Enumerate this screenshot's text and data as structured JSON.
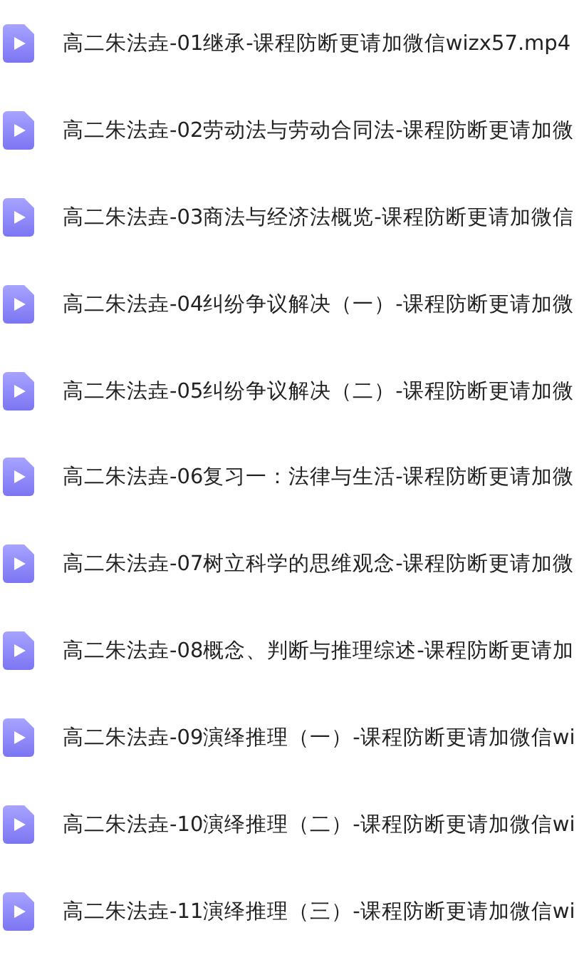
{
  "files": [
    {
      "name": "高二朱法垚-01继承-课程防断更请加微信wizx57.mp4"
    },
    {
      "name": "高二朱法垚-02劳动法与劳动合同法-课程防断更请加微"
    },
    {
      "name": "高二朱法垚-03商法与经济法概览-课程防断更请加微信"
    },
    {
      "name": "高二朱法垚-04纠纷争议解决（一）-课程防断更请加微"
    },
    {
      "name": "高二朱法垚-05纠纷争议解决（二）-课程防断更请加微"
    },
    {
      "name": "高二朱法垚-06复习一：法律与生活-课程防断更请加微"
    },
    {
      "name": "高二朱法垚-07树立科学的思维观念-课程防断更请加微"
    },
    {
      "name": "高二朱法垚-08概念、判断与推理综述-课程防断更请加"
    },
    {
      "name": "高二朱法垚-09演绎推理（一）-课程防断更请加微信wi"
    },
    {
      "name": "高二朱法垚-10演绎推理（二）-课程防断更请加微信wi"
    },
    {
      "name": "高二朱法垚-11演绎推理（三）-课程防断更请加微信wi"
    }
  ]
}
